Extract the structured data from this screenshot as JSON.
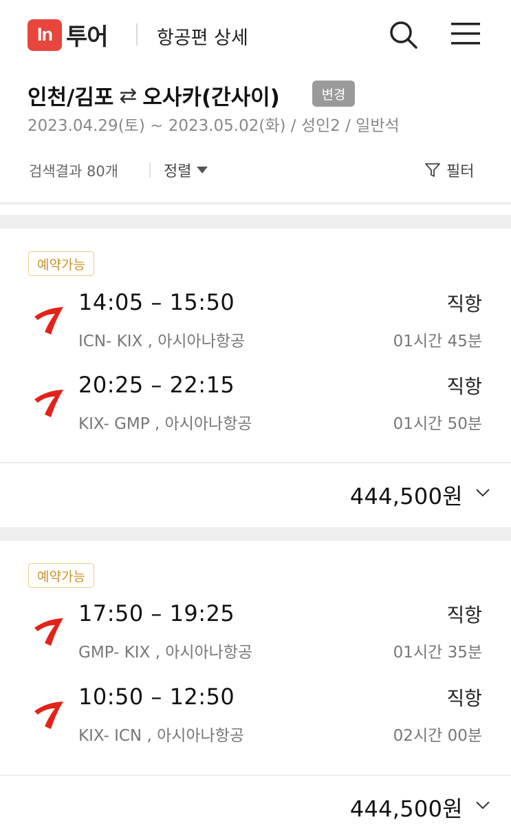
{
  "header": {
    "logo_mark": "In",
    "logo_text": "투어",
    "title": "항공편 상세",
    "icons": [
      "search-icon",
      "menu-icon"
    ]
  },
  "search": {
    "route_from": "인천/김포",
    "route_arrow": "⇄",
    "route_to": "오사카(간사이)",
    "change_label": "변경",
    "trip_info": "2023.04.29(토) ~ 2023.05.02(화) / 성인2 / 일반석",
    "result_count": "검색결과 80개",
    "sort_label": "정렬",
    "filter_label": "필터"
  },
  "colors": {
    "brand": "#e8453c",
    "badge_border": "#e7c98a",
    "badge_text": "#c8932a",
    "airline_red": "#e2231a"
  },
  "results": [
    {
      "status": "예약가능",
      "legs": [
        {
          "times": "14:05 – 15:50",
          "route": "ICN- KIX , 아시아나항공",
          "type": "직항",
          "duration": "01시간 45분"
        },
        {
          "times": "20:25 – 22:15",
          "route": "KIX- GMP , 아시아나항공",
          "type": "직항",
          "duration": "01시간 50분"
        }
      ],
      "price": "444,500원"
    },
    {
      "status": "예약가능",
      "legs": [
        {
          "times": "17:50 – 19:25",
          "route": "GMP- KIX , 아시아나항공",
          "type": "직항",
          "duration": "01시간 35분"
        },
        {
          "times": "10:50 – 12:50",
          "route": "KIX- ICN , 아시아나항공",
          "type": "직항",
          "duration": "02시간 00분"
        }
      ],
      "price": "444,500원"
    }
  ]
}
